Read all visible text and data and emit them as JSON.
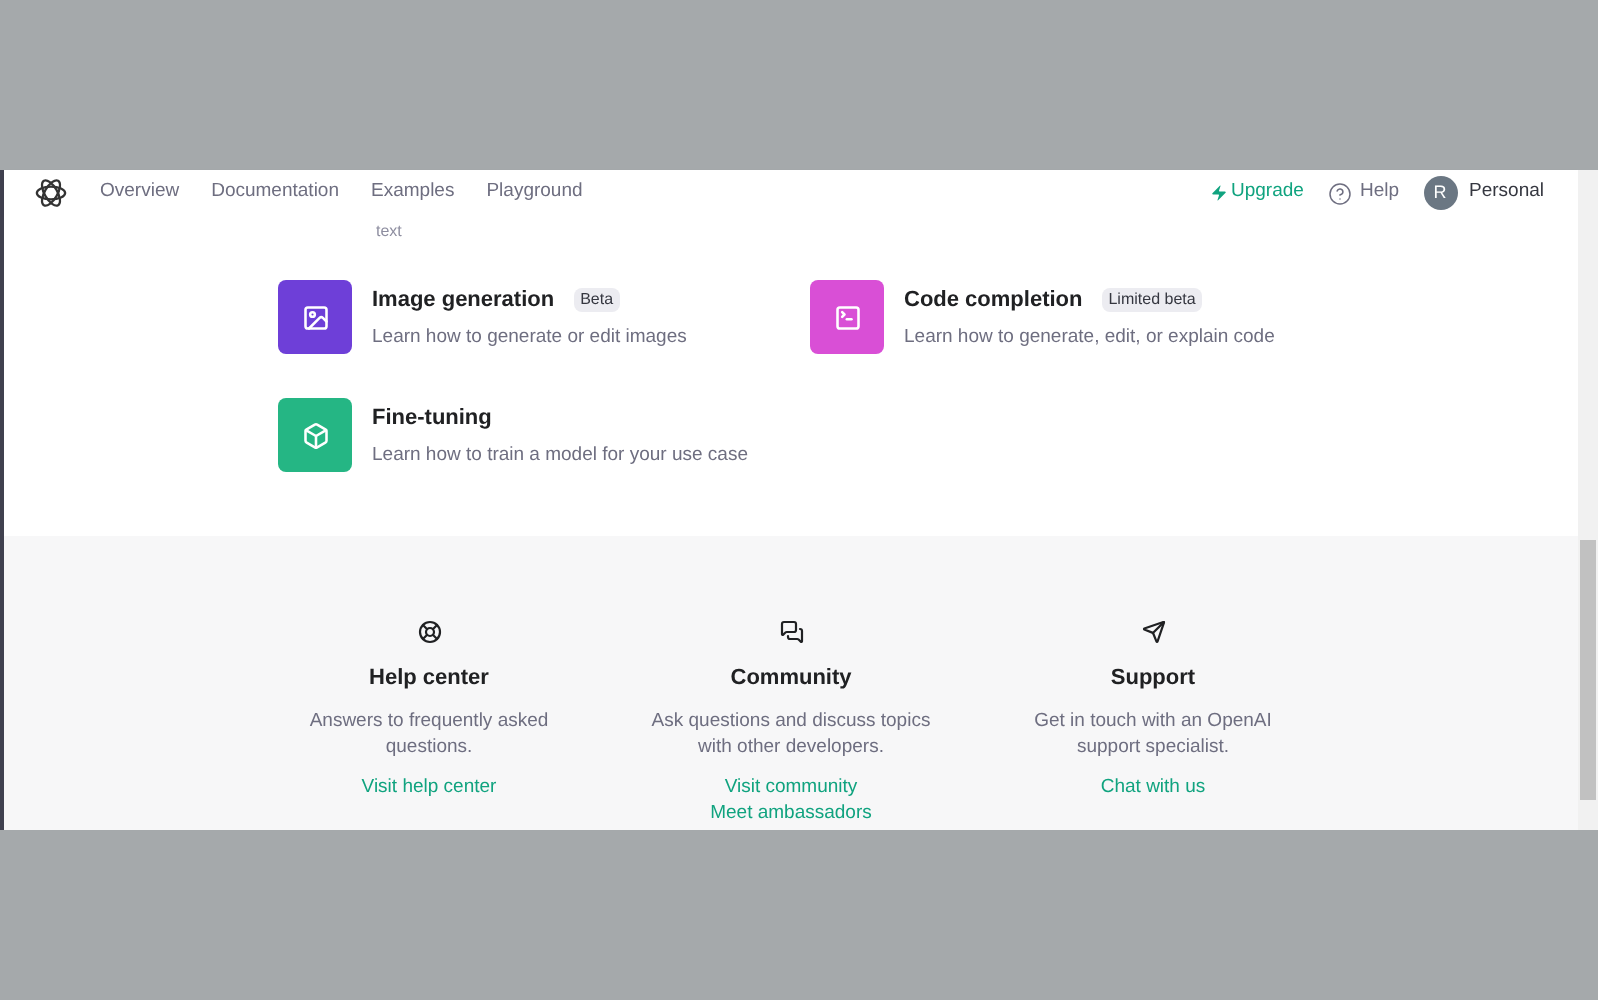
{
  "nav": {
    "links": [
      "Overview",
      "Documentation",
      "Examples",
      "Playground"
    ],
    "upgrade": "Upgrade",
    "help": "Help",
    "avatar": "R",
    "account": "Personal"
  },
  "cut_text": "text",
  "guides": [
    {
      "kind": "image",
      "title": "Image generation",
      "badge": "Beta",
      "description": "Learn how to generate or edit images",
      "color": "#6e3fd8"
    },
    {
      "kind": "code",
      "title": "Code completion",
      "badge": "Limited beta",
      "description": "Learn how to generate, edit, or explain code",
      "color": "#d94fd6"
    },
    {
      "kind": "tune",
      "title": "Fine-tuning",
      "description": "Learn how to train a model for your use case",
      "color": "#25b684"
    }
  ],
  "support": [
    {
      "kind": "help",
      "title": "Help center",
      "description": "Answers to frequently asked questions.",
      "links": [
        "Visit help center"
      ]
    },
    {
      "kind": "community",
      "title": "Community",
      "description": "Ask questions and discuss topics with other developers.",
      "links": [
        "Visit community",
        "Meet ambassadors"
      ]
    },
    {
      "kind": "support",
      "title": "Support",
      "description": "Get in touch with an OpenAI support specialist.",
      "links": [
        "Chat with us"
      ]
    }
  ]
}
